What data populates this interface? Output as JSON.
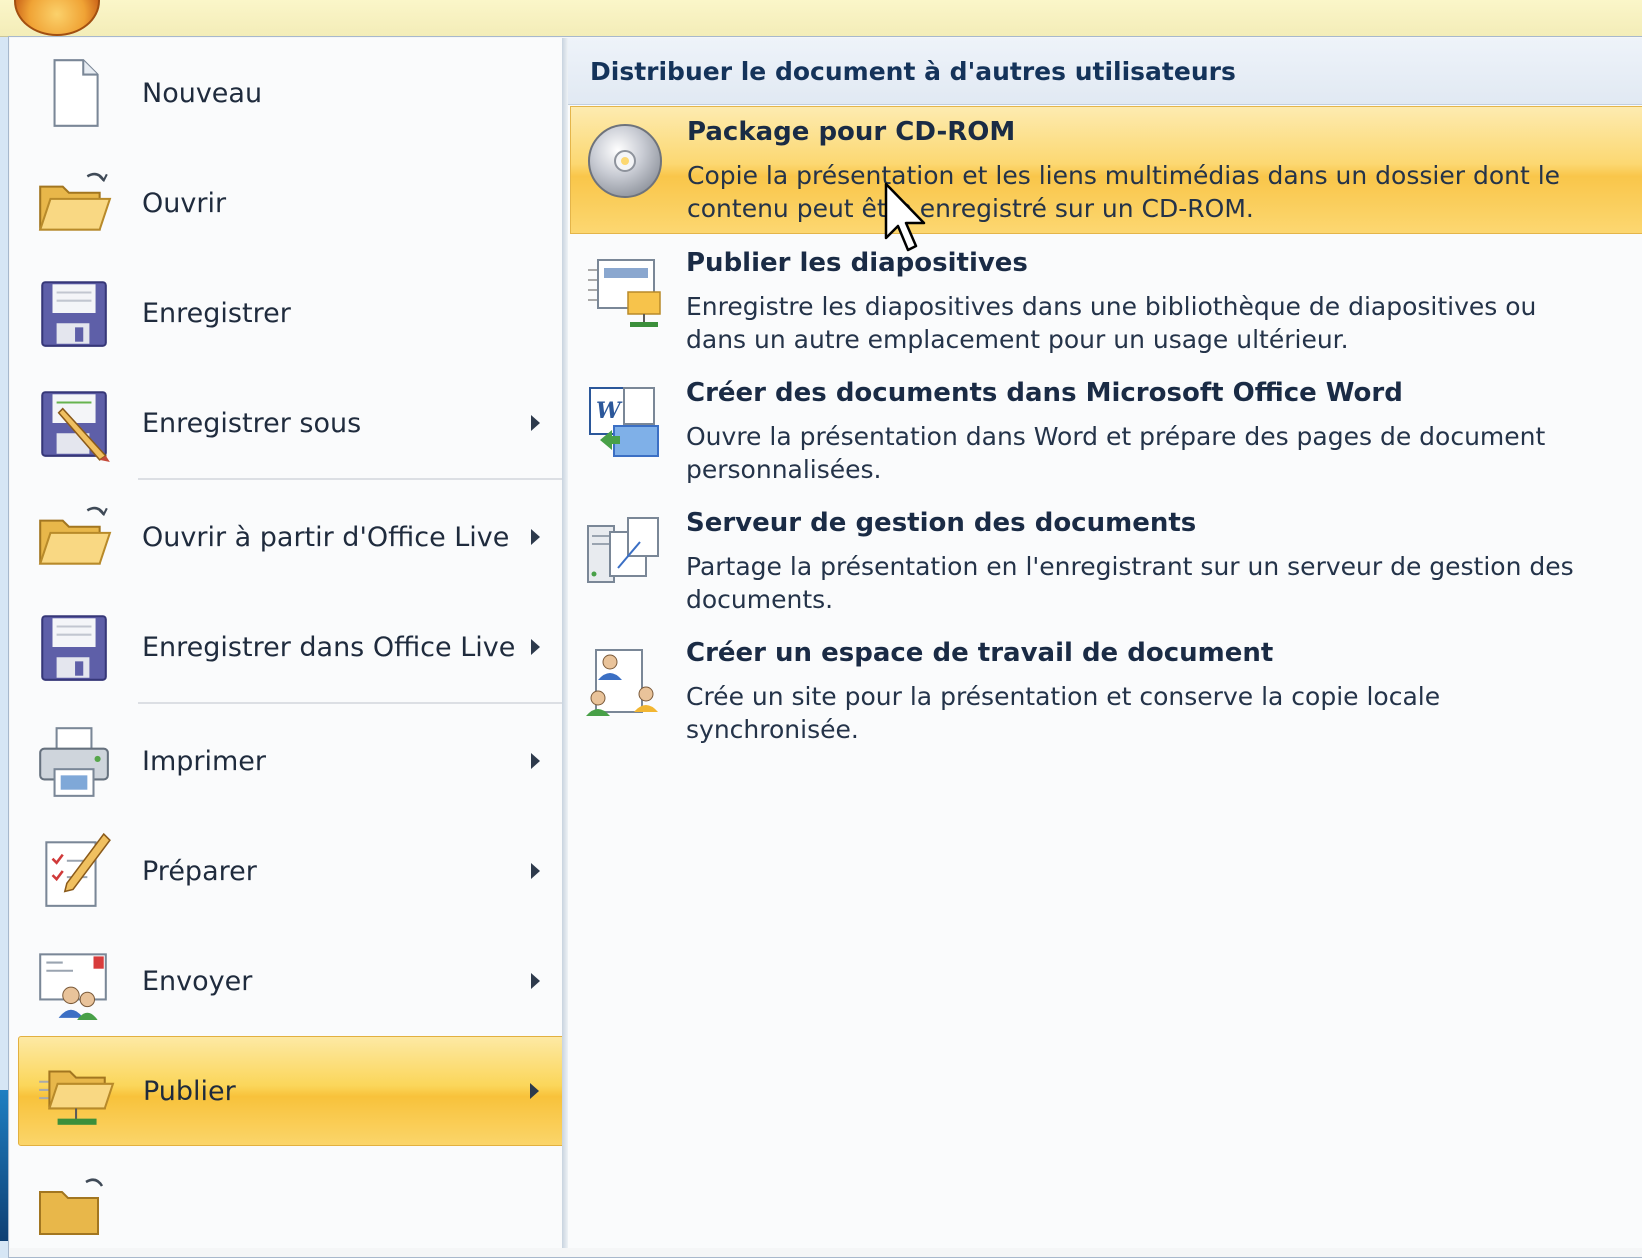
{
  "left_menu": {
    "items": [
      {
        "label": "Nouveau",
        "icon": "new-document-icon"
      },
      {
        "label": "Ouvrir",
        "icon": "open-folder-icon"
      },
      {
        "label": "Enregistrer",
        "icon": "floppy-disk-icon"
      },
      {
        "label": "Enregistrer sous",
        "icon": "save-as-icon"
      },
      {
        "label": "Ouvrir à partir d'Office Live",
        "icon": "open-folder-icon"
      },
      {
        "label": "Enregistrer dans Office Live",
        "icon": "floppy-disk-icon"
      },
      {
        "label": "Imprimer",
        "icon": "printer-icon"
      },
      {
        "label": "Préparer",
        "icon": "prepare-document-icon"
      },
      {
        "label": "Envoyer",
        "icon": "send-users-icon"
      },
      {
        "label": "Publier",
        "icon": "publish-folder-icon"
      }
    ],
    "active_label": "Publier"
  },
  "right_panel": {
    "header": "Distribuer le document à d'autres utilisateurs",
    "items": [
      {
        "title": "Package pour CD-ROM",
        "description": "Copie la présentation et les liens multimédias dans un dossier dont le contenu peut être enregistré sur un CD-ROM.",
        "icon": "cd-rom-icon"
      },
      {
        "title": "Publier les diapositives",
        "description": "Enregistre les diapositives dans une bibliothèque de diapositives ou dans un autre emplacement pour un usage ultérieur.",
        "icon": "publish-slides-icon"
      },
      {
        "title": "Créer des documents dans Microsoft Office Word",
        "description": "Ouvre la présentation dans Word et prépare des pages de document personnalisées.",
        "icon": "word-handouts-icon"
      },
      {
        "title": "Serveur de gestion des documents",
        "description": "Partage la présentation en l'enregistrant sur un serveur de gestion des documents.",
        "icon": "document-server-icon"
      },
      {
        "title": "Créer un espace de travail de document",
        "description": "Crée un site pour la présentation et conserve la copie locale synchronisée.",
        "icon": "workspace-users-icon"
      }
    ],
    "active_title": "Package pour CD-ROM"
  },
  "colors": {
    "highlight": "#fbd65a",
    "header_text": "#14335a",
    "pane_bg": "#fafbfc"
  }
}
